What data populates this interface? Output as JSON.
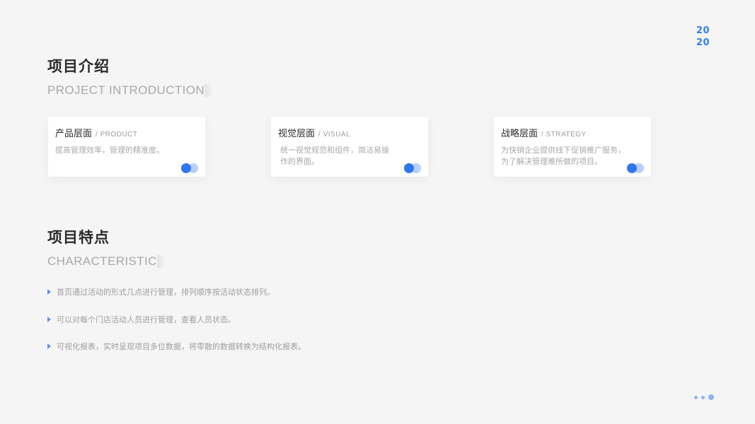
{
  "year": {
    "line1": "20",
    "line2": "20"
  },
  "intro": {
    "title": "项目介绍",
    "subtitle": "PROJECT INTRODUCTION"
  },
  "cards": [
    {
      "title": "产品层面",
      "tag": "/ PRODUCT",
      "desc": "提高管理效率，管理的精准度。"
    },
    {
      "title": "视觉层面",
      "tag": "/ VISUAL",
      "desc": "统一视觉规范和组件，简洁易操作的界面。"
    },
    {
      "title": "战略层面",
      "tag": "/ STRATEGY",
      "desc": "为快销企业提供线下促销推广服务，为了解决管理难所做的项目。"
    }
  ],
  "features": {
    "title": "项目特点",
    "subtitle": "CHARACTERISTIC",
    "items": [
      "首页通过活动的形式几点进行管理，排列顺序按活动状态排列。",
      "可以对每个门店活动人员进行管理，查看人员状态。",
      "可视化报表，实时呈现项目多位数据，将零散的数据转换为结构化报表。"
    ]
  },
  "colors": {
    "accent": "#2f75ef",
    "accent_light": "#b8cff8",
    "background": "#f5f5f6"
  }
}
